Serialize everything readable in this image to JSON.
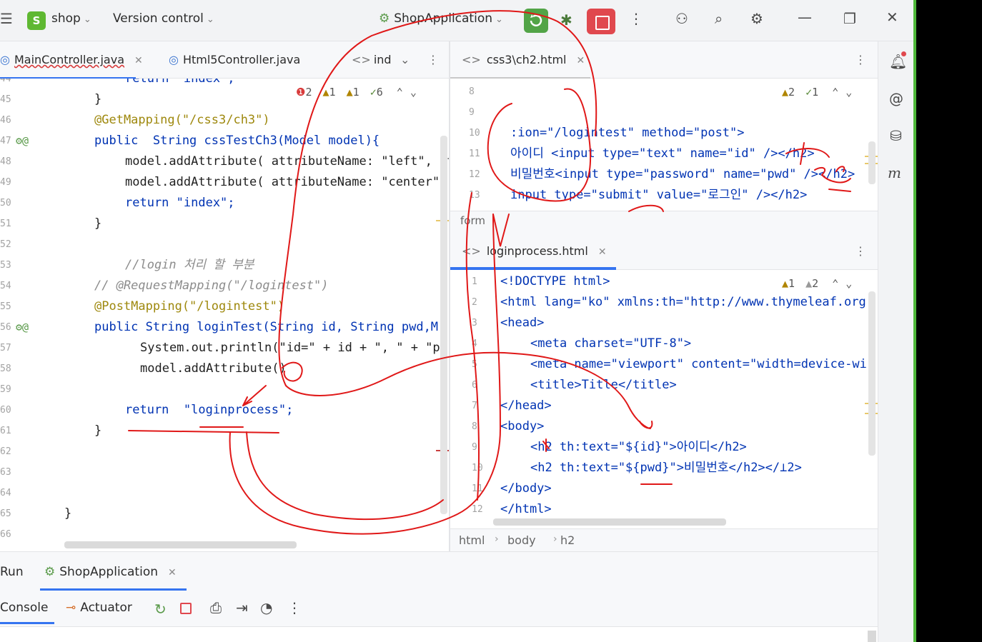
{
  "titlebar": {
    "project_badge": "S",
    "project_name": "shop",
    "vcs": "Version control",
    "run_config": "ShopApplication"
  },
  "left_editor": {
    "tabs": [
      {
        "label": "MainController.java",
        "active": true
      },
      {
        "label": "Html5Controller.java",
        "active": false
      },
      {
        "label": "ind",
        "active": false
      }
    ],
    "inspections": {
      "errors": "2",
      "warn1": "1",
      "warn2": "1",
      "ok": "6"
    },
    "lines": [
      {
        "num": "44",
        "text": "return \"index\";"
      },
      {
        "num": "45",
        "text": "}"
      },
      {
        "num": "46",
        "text": "@GetMapping(\"/css3/ch3\")"
      },
      {
        "num": "47",
        "text": "public  String cssTestCh3(Model model){"
      },
      {
        "num": "48",
        "text": "model.addAttribute( attributeName: \"left\", attrib"
      },
      {
        "num": "49",
        "text": "model.addAttribute( attributeName: \"center\",  a"
      },
      {
        "num": "50",
        "text": "return \"index\";"
      },
      {
        "num": "51",
        "text": "}"
      },
      {
        "num": "52",
        "text": ""
      },
      {
        "num": "53",
        "text": "//login 처리 할 부분"
      },
      {
        "num": "54",
        "text": "// @RequestMapping(\"/logintest\")"
      },
      {
        "num": "55",
        "text": "@PostMapping(\"/logintest\")"
      },
      {
        "num": "56",
        "text": "public String loginTest(String id, String pwd,M"
      },
      {
        "num": "57",
        "text": "System.out.println(\"id=\" + id + \", \" + \"p"
      },
      {
        "num": "58",
        "text": "model.addAttribute()"
      },
      {
        "num": "59",
        "text": ""
      },
      {
        "num": "60",
        "text": "return  \"loginprocess\";"
      },
      {
        "num": "61",
        "text": "}"
      },
      {
        "num": "62",
        "text": ""
      },
      {
        "num": "63",
        "text": ""
      },
      {
        "num": "64",
        "text": ""
      },
      {
        "num": "65",
        "text": "}"
      },
      {
        "num": "66",
        "text": ""
      }
    ]
  },
  "right_top_editor": {
    "tab": "css3\\ch2.html",
    "inspections": {
      "warn": "2",
      "ok": "1"
    },
    "lines": [
      {
        "num": "8",
        "text": ""
      },
      {
        "num": "9",
        "text": ""
      },
      {
        "num": "10",
        "text": ":ion=\"/logintest\" method=\"post\">"
      },
      {
        "num": "11",
        "text": "아이디 <input type=\"text\" name=\"id\" /></h2>"
      },
      {
        "num": "12",
        "text": "비밀번호<input type=\"password\" name=\"pwd\" /></h2>"
      },
      {
        "num": "13",
        "text": "input type=\"submit\" value=\"로그인\" /></h2>"
      }
    ],
    "breadcrumb": "form"
  },
  "right_bottom_editor": {
    "tab": "loginprocess.html",
    "inspections": {
      "warn1": "1",
      "warn2": "2"
    },
    "lines": [
      {
        "num": "1",
        "text": "<!DOCTYPE html>"
      },
      {
        "num": "2",
        "text": "<html lang=\"ko\" xmlns:th=\"http://www.thymeleaf.org"
      },
      {
        "num": "3",
        "text": "<head>"
      },
      {
        "num": "4",
        "text": "<meta charset=\"UTF-8\">"
      },
      {
        "num": "5",
        "text": "<meta name=\"viewport\" content=\"width=device-wi"
      },
      {
        "num": "6",
        "text": "<title>Title</title>"
      },
      {
        "num": "7",
        "text": "</head>"
      },
      {
        "num": "8",
        "text": "<body>"
      },
      {
        "num": "9",
        "text": "<h2 th:text=\"${id}\">아이디</h2>"
      },
      {
        "num": "10",
        "text": "<h2 th:text=\"${pwd}\">비밀번호</h2></⊥2>"
      },
      {
        "num": "11",
        "text": "</body>"
      },
      {
        "num": "12",
        "text": "</html>"
      }
    ],
    "breadcrumb": [
      "html",
      "body",
      "h2"
    ]
  },
  "bottom": {
    "run_label": "Run",
    "run_tab": "ShopApplication",
    "console_label": "Console",
    "actuator_label": "Actuator"
  },
  "right_strip_icons": [
    "notifications-icon",
    "spiral-icon",
    "database-icon",
    "m-icon"
  ],
  "accent_green": "#52a447",
  "stop_red": "#e0484e",
  "annotation_red": "#e01818"
}
